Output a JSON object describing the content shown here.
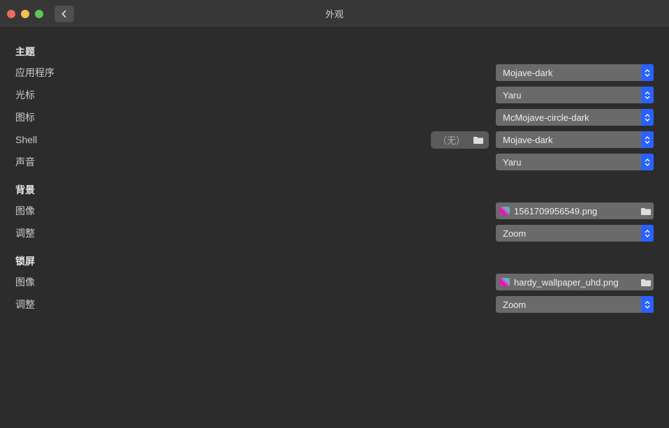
{
  "window": {
    "title": "外观"
  },
  "sections": {
    "theme": {
      "heading": "主题",
      "app_label": "应用程序",
      "app_value": "Mojave-dark",
      "cursor_label": "光标",
      "cursor_value": "Yaru",
      "icon_label": "图标",
      "icon_value": "McMojave-circle-dark",
      "shell_label": "Shell",
      "shell_none": "（无）",
      "shell_value": "Mojave-dark",
      "sound_label": "声音",
      "sound_value": "Yaru"
    },
    "background": {
      "heading": "背景",
      "image_label": "图像",
      "image_value": "1561709956549.png",
      "adjust_label": "调整",
      "adjust_value": "Zoom"
    },
    "lockscreen": {
      "heading": "锁屏",
      "image_label": "图像",
      "image_value": "hardy_wallpaper_uhd.png",
      "adjust_label": "调整",
      "adjust_value": "Zoom"
    }
  }
}
